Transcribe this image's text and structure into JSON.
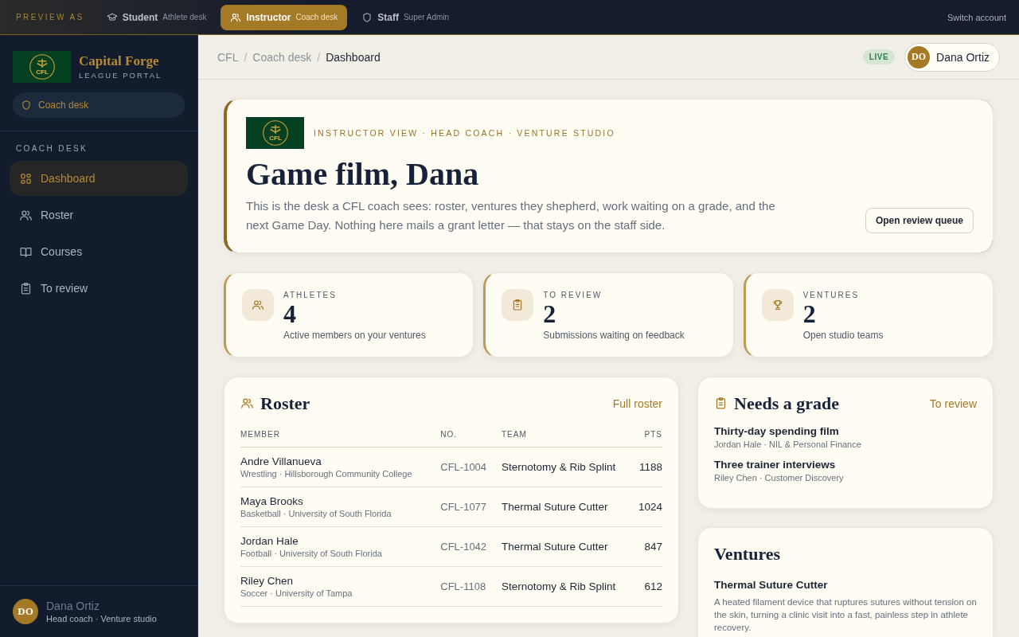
{
  "preview_bar": {
    "label": "PREVIEW AS",
    "roles": [
      {
        "name": "Student",
        "desk": "Athlete desk",
        "selected": false
      },
      {
        "name": "Instructor",
        "desk": "Coach desk",
        "selected": true
      },
      {
        "name": "Staff",
        "desk": "Super Admin",
        "selected": false
      }
    ],
    "switch_link": "Switch account"
  },
  "sidebar": {
    "logo_text": "CFL",
    "brand": "Capital Forge",
    "tagline": "LEAGUE PORTAL",
    "desk_chip": "Coach desk",
    "section": "COACH DESK",
    "items": [
      {
        "label": "Dashboard",
        "selected": true
      },
      {
        "label": "Roster",
        "selected": false
      },
      {
        "label": "Courses",
        "selected": false
      },
      {
        "label": "To review",
        "selected": false
      }
    ],
    "user": {
      "initials": "DO",
      "name": "Dana Ortiz",
      "role": "Head coach · Venture studio"
    }
  },
  "header": {
    "breadcrumb": [
      "CFL",
      "Coach desk",
      "Dashboard"
    ],
    "separator": "/",
    "status": "LIVE",
    "user": {
      "initials": "DO",
      "name": "Dana Ortiz"
    }
  },
  "hero": {
    "logo_text": "CFL",
    "eyebrow": "INSTRUCTOR VIEW · HEAD COACH · VENTURE STUDIO",
    "title": "Game film, Dana",
    "text": "This is the desk a CFL coach sees: roster, ventures they shepherd, work waiting on a grade, and the next Game Day. Nothing here mails a grant letter — that stays on the staff side.",
    "button": "Open review queue"
  },
  "stats": [
    {
      "label": "ATHLETES",
      "value": "4",
      "note": "Active members on your ventures"
    },
    {
      "label": "TO REVIEW",
      "value": "2",
      "note": "Submissions waiting on feedback"
    },
    {
      "label": "VENTURES",
      "value": "2",
      "note": "Open studio teams"
    }
  ],
  "roster": {
    "title": "Roster",
    "link": "Full roster",
    "columns": [
      "MEMBER",
      "NO.",
      "TEAM",
      "PTS"
    ],
    "rows": [
      {
        "name": "Andre Villanueva",
        "detail": "Wrestling · Hillsborough Community College",
        "number": "CFL-1004",
        "team": "Sternotomy & Rib Splint",
        "points": "1188"
      },
      {
        "name": "Maya Brooks",
        "detail": "Basketball · University of South Florida",
        "number": "CFL-1077",
        "team": "Thermal Suture Cutter",
        "points": "1024"
      },
      {
        "name": "Jordan Hale",
        "detail": "Football · University of South Florida",
        "number": "CFL-1042",
        "team": "Thermal Suture Cutter",
        "points": "847"
      },
      {
        "name": "Riley Chen",
        "detail": "Soccer · University of Tampa",
        "number": "CFL-1108",
        "team": "Sternotomy & Rib Splint",
        "points": "612"
      }
    ]
  },
  "needs_grade": {
    "title": "Needs a grade",
    "link": "To review",
    "items": [
      {
        "title": "Thirty-day spending film",
        "detail": "Jordan Hale · NIL & Personal Finance"
      },
      {
        "title": "Three trainer interviews",
        "detail": "Riley Chen · Customer Discovery"
      }
    ]
  },
  "ventures": {
    "title": "Ventures",
    "items": [
      {
        "name": "Thermal Suture Cutter",
        "description": "A heated filament device that ruptures sutures without tension on the skin, turning a clinic visit into a fast, painless step in athlete recovery."
      }
    ]
  }
}
